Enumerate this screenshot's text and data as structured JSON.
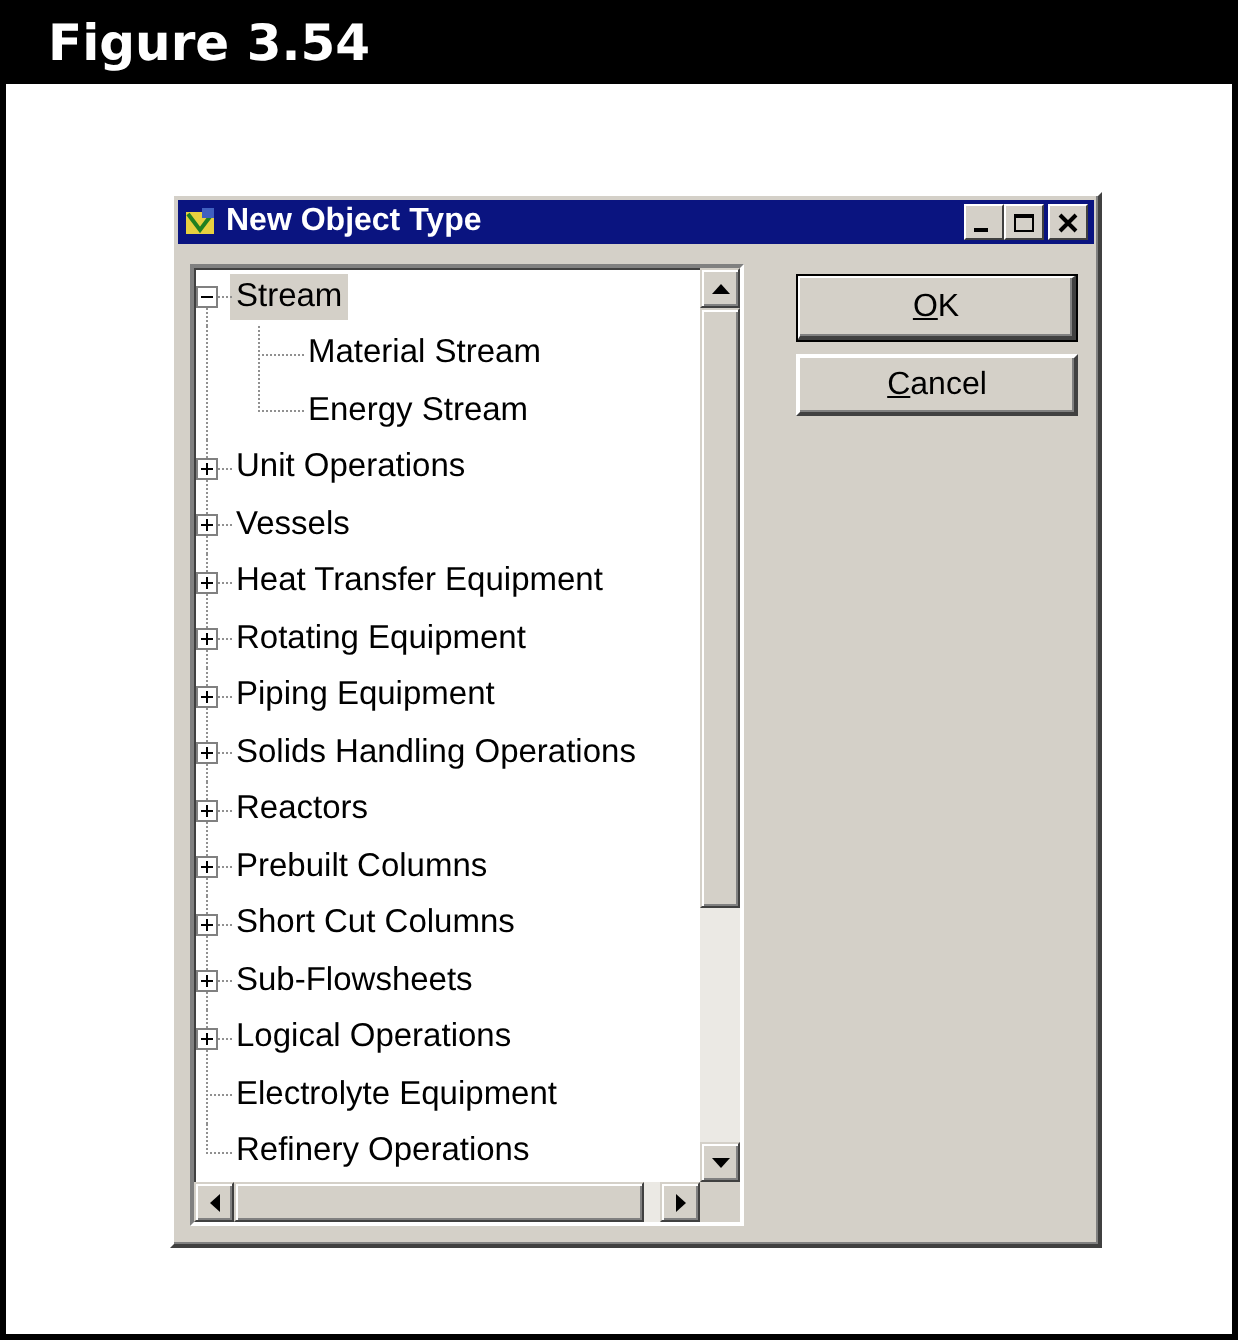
{
  "figure": {
    "caption": "Figure 3.54"
  },
  "dialog": {
    "title": "New Object Type",
    "tree": [
      {
        "label": "Stream",
        "selected": true,
        "expanded": true,
        "children": [
          {
            "label": "Material Stream",
            "selected": false
          },
          {
            "label": "Energy Stream",
            "selected": false
          }
        ]
      },
      {
        "label": "Unit Operations",
        "selected": false,
        "expanded": false
      },
      {
        "label": "Vessels",
        "selected": false,
        "expanded": false
      },
      {
        "label": "Heat Transfer Equipment",
        "selected": false,
        "expanded": false
      },
      {
        "label": "Rotating Equipment",
        "selected": false,
        "expanded": false
      },
      {
        "label": "Piping Equipment",
        "selected": false,
        "expanded": false
      },
      {
        "label": "Solids Handling Operations",
        "selected": false,
        "expanded": false
      },
      {
        "label": "Reactors",
        "selected": false,
        "expanded": false
      },
      {
        "label": "Prebuilt Columns",
        "selected": false,
        "expanded": false
      },
      {
        "label": "Short Cut Columns",
        "selected": false,
        "expanded": false
      },
      {
        "label": "Sub-Flowsheets",
        "selected": false,
        "expanded": false
      },
      {
        "label": "Logical Operations",
        "selected": false,
        "expanded": false
      },
      {
        "label": "Electrolyte Equipment",
        "selected": false
      },
      {
        "label": "Refinery Operations",
        "selected": false
      }
    ],
    "buttons": [
      {
        "access_key": "O",
        "label_rest": "K",
        "default": true
      },
      {
        "access_key": "C",
        "label_rest": "ancel",
        "default": false
      }
    ]
  }
}
